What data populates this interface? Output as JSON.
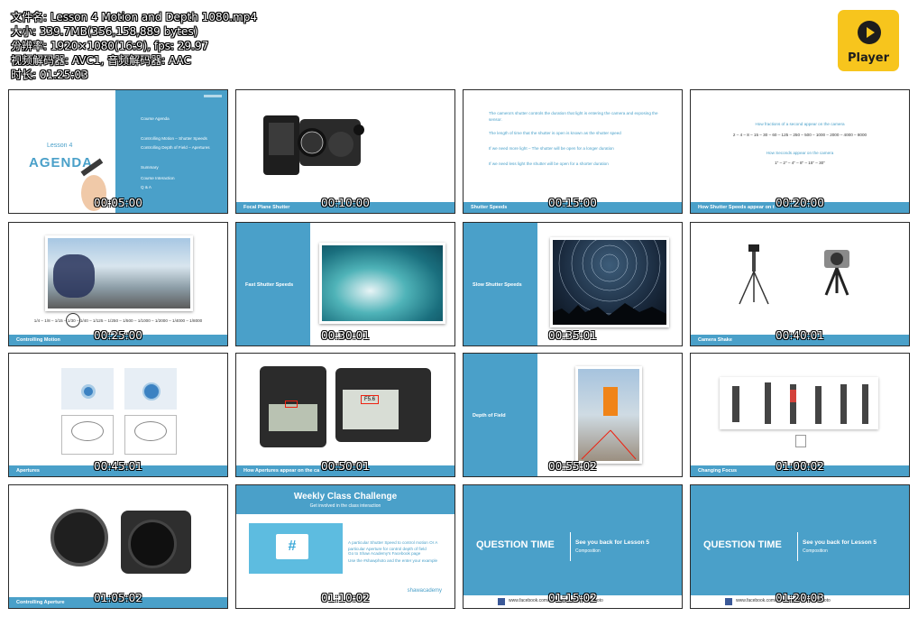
{
  "file_info": {
    "name": "文件名: Lesson 4 Motion and Depth 1080.mp4",
    "size": "大小: 339.7MB(356,158,889 bytes)",
    "resolution": "分辨率: 1920×1080(16:9), fps: 29.97",
    "codec": "视频解码器: AVC1, 音频解码器: AAC",
    "duration": "时长: 01:25:03"
  },
  "player_logo": {
    "text": "Player",
    "icon": "play-icon",
    "bg_color": "#f7c51d"
  },
  "accent_color": "#4aa0c9",
  "thumbnails": [
    {
      "timestamp": "00:05:00",
      "caption": "",
      "lesson": "Lesson 4",
      "agenda": "AGENDA",
      "items": [
        "Course Agenda",
        "Controlling Motion – Shutter Speeds",
        "Controlling Depth of Field – Apertures",
        "Summary",
        "Course Interaction",
        "Q & A"
      ]
    },
    {
      "timestamp": "00:10:00",
      "caption": "Focal Plane Shutter"
    },
    {
      "timestamp": "00:15:00",
      "caption": "Shutter Speeds",
      "bullets": [
        "The camera's shutter controls the duration that light is entering the camera and exposing the sensor.",
        "The length of time that the shutter is open is known as the shutter speed",
        "If we need more light – The shutter will be open for a longer duration",
        "If we need less light the shutter will be open for a shorter duration"
      ]
    },
    {
      "timestamp": "00:20:00",
      "caption": "How Shutter Speeds appear on t",
      "line1": "How fractions of a second appear on the camera",
      "line2": "2 – 4 – 8 – 15 – 30 – 60 – 125 – 250 – 500 – 1000 – 2000 – 4000 – 8000",
      "line3": "How Seconds appear on the camera",
      "line4": "1\" – 2\" – 4\" – 8\" – 15\" – 30\""
    },
    {
      "timestamp": "00:25:00",
      "caption": "Controlling Motion",
      "scale": "1/4 – 1/8 – 1/15 – 1/30 – 1/40 – 1/125 – 1/250 – 1/500 – 1/1000 – 1/2000 – 1/4000 – 1/8000"
    },
    {
      "timestamp": "00:30:01",
      "caption": "",
      "side": "Fast Shutter Speeds"
    },
    {
      "timestamp": "00:35:01",
      "caption": "",
      "side": "Slow Shutter Speeds"
    },
    {
      "timestamp": "00:40:01",
      "caption": "Camera Shake"
    },
    {
      "timestamp": "00:45:01",
      "caption": "Apertures"
    },
    {
      "timestamp": "00:50:01",
      "caption": "How Apertures appear on the ca",
      "aperture_value": "F5.6"
    },
    {
      "timestamp": "00:55:02",
      "caption": "",
      "side": "Depth of Field"
    },
    {
      "timestamp": "01:00:02",
      "caption": "Changing Focus"
    },
    {
      "timestamp": "01:05:02",
      "caption": "Controlling Aperture"
    },
    {
      "timestamp": "01:10:02",
      "caption": "",
      "title": "Weekly Class Challenge",
      "subtitle": "Get involved in the class interaction",
      "bullets": [
        "A particular Shutter Speed to control motion Or A particular Aperture for control depth of field",
        "Go to Shaw Academy's Facebook page",
        "Use the #shawphoto and the enter your example"
      ],
      "brand": "shawacademy",
      "hashtag": "#"
    },
    {
      "timestamp": "01:15:02",
      "caption": "",
      "qt": "QUESTION TIME",
      "see": "See you back for Lesson 5",
      "topic": "Composition",
      "footer": "www.facebook.com/shawacademy   #shawphoto"
    },
    {
      "timestamp": "01:20:03",
      "caption": "",
      "qt": "QUESTION TIME",
      "see": "See you back for Lesson 5",
      "topic": "Composition",
      "footer": "www.facebook.com/shawacademy   #shawphoto"
    }
  ]
}
